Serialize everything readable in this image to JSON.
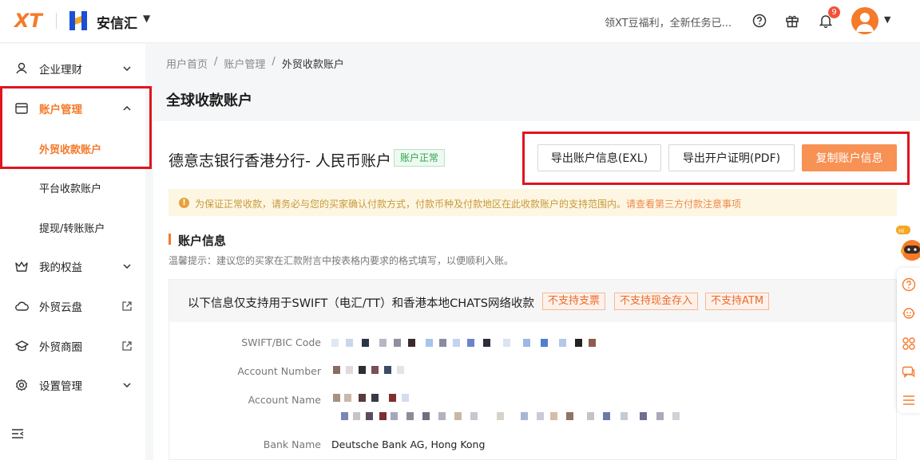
{
  "header": {
    "logo_text": "XT",
    "brand_name": "安信汇",
    "promo_text": "领XT豆福利，全新任务已...",
    "notification_count": "9",
    "accent": "#f57a2a"
  },
  "sidebar": {
    "items": [
      {
        "label": "企业理财",
        "icon": "wealth-icon"
      },
      {
        "label": "账户管理",
        "icon": "account-card-icon"
      },
      {
        "label": "我的权益",
        "icon": "crown-icon"
      },
      {
        "label": "外贸云盘",
        "icon": "cloud-icon"
      },
      {
        "label": "外贸商圈",
        "icon": "graduation-cap-icon"
      },
      {
        "label": "设置管理",
        "icon": "settings-icon"
      }
    ],
    "sub_items": [
      {
        "label": "外贸收款账户"
      },
      {
        "label": "平台收款账户"
      },
      {
        "label": "提现/转账账户"
      }
    ]
  },
  "breadcrumb": [
    "用户首页",
    "/",
    "账户管理",
    "/",
    "外贸收款账户"
  ],
  "page_title": "全球收款账户",
  "account": {
    "title": "德意志银行香港分行- 人民币账户",
    "status": "账户正常",
    "btn_export_info": "导出账户信息(EXL)",
    "btn_export_cert": "导出开户证明(PDF)",
    "btn_copy": "复制账户信息"
  },
  "notice": {
    "text": "为保证正常收款，请务必与您的买家确认付款方式，付款币种及付款地区在此收款账户的支持范围内。",
    "link": "请查看第三方付款注意事项"
  },
  "section": {
    "title": "账户信息",
    "tip": "温馨提示：建议您的买家在汇款附言中按表格内要求的格式填写，以便顺利入账。"
  },
  "info_panel": {
    "header": "以下信息仅支持用于SWIFT（电汇/TT）和香港本地CHATS网络收款",
    "tags": [
      "不支持支票",
      "不支持现金存入",
      "不支持ATM"
    ],
    "rows": [
      {
        "label": "SWIFT/BIC Code",
        "value": ""
      },
      {
        "label": "Account Number",
        "value": ""
      },
      {
        "label": "Account Name",
        "value": ""
      },
      {
        "label": "Bank Name",
        "value": "Deutsche Bank AG, Hong Kong"
      }
    ]
  }
}
